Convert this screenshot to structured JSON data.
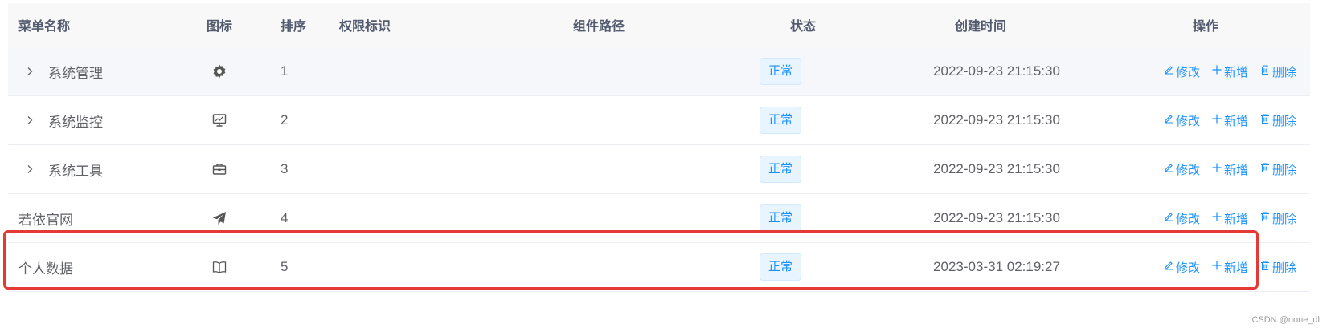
{
  "columns": {
    "name": "菜单名称",
    "icon": "图标",
    "sort": "排序",
    "perms": "权限标识",
    "component": "组件路径",
    "status": "状态",
    "created": "创建时间",
    "ops": "操作"
  },
  "rows": [
    {
      "name": "系统管理",
      "icon": "gear-icon",
      "sort": "1",
      "perms": "",
      "component": "",
      "status": "正常",
      "created": "2022-09-23 21:15:30",
      "expandable": true
    },
    {
      "name": "系统监控",
      "icon": "monitor-icon",
      "sort": "2",
      "perms": "",
      "component": "",
      "status": "正常",
      "created": "2022-09-23 21:15:30",
      "expandable": true
    },
    {
      "name": "系统工具",
      "icon": "toolbox-icon",
      "sort": "3",
      "perms": "",
      "component": "",
      "status": "正常",
      "created": "2022-09-23 21:15:30",
      "expandable": true
    },
    {
      "name": "若依官网",
      "icon": "paper-plane-icon",
      "sort": "4",
      "perms": "",
      "component": "",
      "status": "正常",
      "created": "2022-09-23 21:15:30",
      "expandable": false
    },
    {
      "name": "个人数据",
      "icon": "book-icon",
      "sort": "5",
      "perms": "",
      "component": "",
      "status": "正常",
      "created": "2023-03-31 02:19:27",
      "expandable": false
    }
  ],
  "actions": {
    "edit": "修改",
    "add": "新增",
    "delete": "删除"
  },
  "colors": {
    "accent": "#1890ff",
    "highlight": "#e53935"
  },
  "watermark": "CSDN @none_dl"
}
